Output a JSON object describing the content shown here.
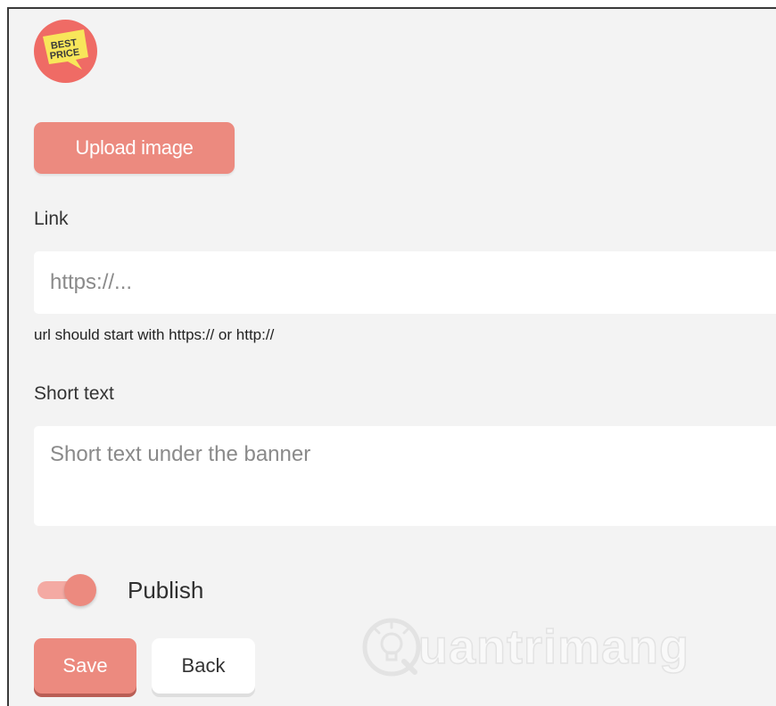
{
  "logo": {
    "line1": "BEST",
    "line2": "PRICE",
    "colors": {
      "circle": "#ef6b65",
      "tag": "#f8e65a",
      "text": "#3a3a3a"
    }
  },
  "upload": {
    "label": "Upload image"
  },
  "link": {
    "label": "Link",
    "placeholder": "https://...",
    "value": "",
    "helper": "url should start with https:// or http://"
  },
  "short_text": {
    "label": "Short text",
    "placeholder": "Short text under the banner",
    "value": ""
  },
  "publish": {
    "label": "Publish",
    "on": true
  },
  "actions": {
    "save_label": "Save",
    "back_label": "Back"
  },
  "watermark": {
    "text": "uantrimang",
    "icon": "lightbulb-q-icon"
  },
  "colors": {
    "accent": "#ec8a7f",
    "accent_light": "#f4aaa3",
    "background": "#f3f3f3",
    "input_bg": "#ffffff"
  }
}
